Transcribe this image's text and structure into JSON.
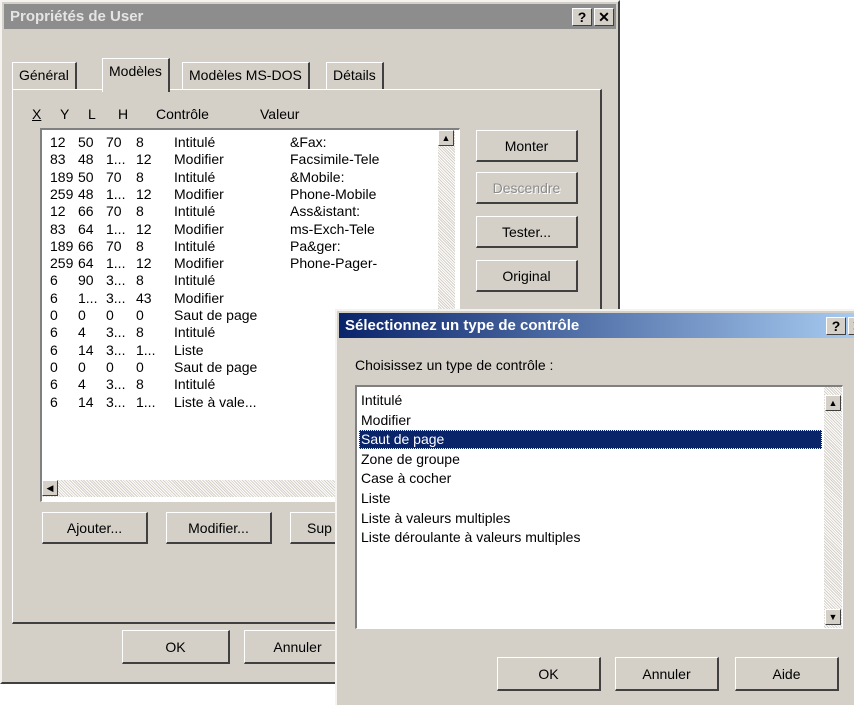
{
  "main_window": {
    "title": "Propriétés de User",
    "help_btn": "?",
    "close_btn": "✕",
    "tabs": [
      {
        "label": "Général"
      },
      {
        "label": "Modèles"
      },
      {
        "label": "Modèles MS-DOS"
      },
      {
        "label": "Détails"
      }
    ],
    "columns": {
      "x": "X",
      "y": "Y",
      "l": "L",
      "h": "H",
      "controle": "Contrôle",
      "valeur": "Valeur"
    },
    "rows": [
      {
        "x": "12",
        "y": "50",
        "l": "70",
        "h": "8",
        "controle": "Intitulé",
        "valeur": "&Fax:"
      },
      {
        "x": "83",
        "y": "48",
        "l": "1...",
        "h": "12",
        "controle": "Modifier",
        "valeur": "Facsimile-Tele"
      },
      {
        "x": "189",
        "y": "50",
        "l": "70",
        "h": "8",
        "controle": "Intitulé",
        "valeur": "&Mobile:"
      },
      {
        "x": "259",
        "y": "48",
        "l": "1...",
        "h": "12",
        "controle": "Modifier",
        "valeur": "Phone-Mobile"
      },
      {
        "x": "12",
        "y": "66",
        "l": "70",
        "h": "8",
        "controle": "Intitulé",
        "valeur": "Ass&istant:"
      },
      {
        "x": "83",
        "y": "64",
        "l": "1...",
        "h": "12",
        "controle": "Modifier",
        "valeur": "ms-Exch-Tele"
      },
      {
        "x": "189",
        "y": "66",
        "l": "70",
        "h": "8",
        "controle": "Intitulé",
        "valeur": "Pa&ger:"
      },
      {
        "x": "259",
        "y": "64",
        "l": "1...",
        "h": "12",
        "controle": "Modifier",
        "valeur": "Phone-Pager-"
      },
      {
        "x": "6",
        "y": "90",
        "l": "3...",
        "h": "8",
        "controle": "Intitulé",
        "valeur": ""
      },
      {
        "x": "6",
        "y": "1...",
        "l": "3...",
        "h": "43",
        "controle": "Modifier",
        "valeur": ""
      },
      {
        "x": "0",
        "y": "0",
        "l": "0",
        "h": "0",
        "controle": "Saut de page",
        "valeur": ""
      },
      {
        "x": "6",
        "y": "4",
        "l": "3...",
        "h": "8",
        "controle": "Intitulé",
        "valeur": ""
      },
      {
        "x": "6",
        "y": "14",
        "l": "3...",
        "h": "1...",
        "controle": "Liste",
        "valeur": ""
      },
      {
        "x": "0",
        "y": "0",
        "l": "0",
        "h": "0",
        "controle": "Saut de page",
        "valeur": ""
      },
      {
        "x": "6",
        "y": "4",
        "l": "3...",
        "h": "8",
        "controle": "Intitulé",
        "valeur": ""
      },
      {
        "x": "6",
        "y": "14",
        "l": "3...",
        "h": "1...",
        "controle": "Liste à vale...",
        "valeur": ""
      }
    ],
    "buttons": {
      "monter": "Monter",
      "descendre": "Descendre",
      "tester": "Tester...",
      "original": "Original",
      "ajouter": "Ajouter...",
      "modifier": "Modifier...",
      "supprimer": "Sup",
      "ok": "OK",
      "annuler": "Annuler"
    }
  },
  "dialog": {
    "title": "Sélectionnez un type de contrôle",
    "help_btn": "?",
    "close_btn": "✕",
    "prompt": "Choisissez un type de contrôle :",
    "items": [
      "Intitulé",
      "Modifier",
      "Saut de page",
      "Zone de groupe",
      "Case à cocher",
      "Liste",
      "Liste à valeurs multiples",
      "Liste déroulante à valeurs multiples"
    ],
    "selected": "Saut de page",
    "buttons": {
      "ok": "OK",
      "annuler": "Annuler",
      "aide": "Aide"
    }
  },
  "colors": {
    "window_bg": "#d4d0c8",
    "active_title": "#0a246a",
    "inactive_title": "#8d8d8d",
    "selection": "#0a246a"
  }
}
